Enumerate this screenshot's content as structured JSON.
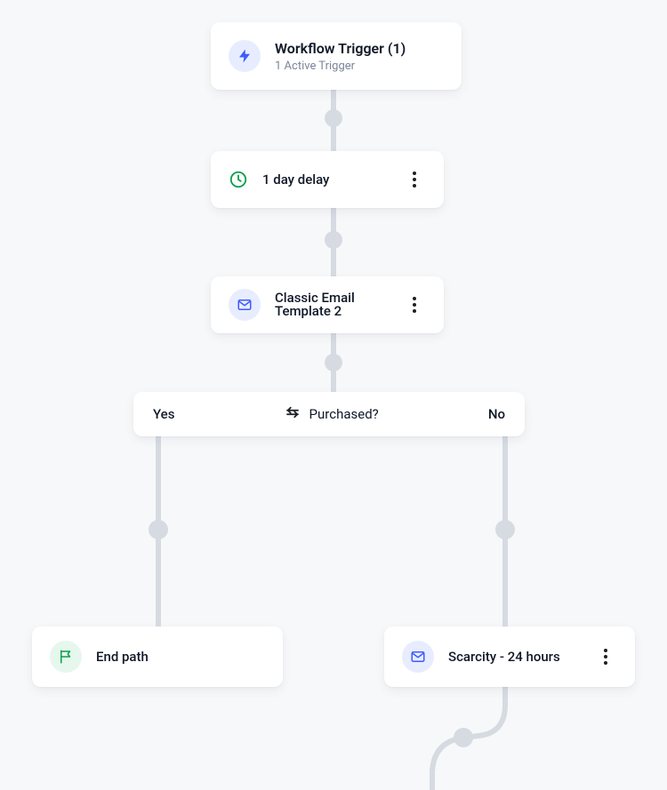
{
  "trigger": {
    "title": "Workflow Trigger (1)",
    "subtitle": "1 Active Trigger"
  },
  "delay": {
    "label": "1 day delay"
  },
  "email1": {
    "label": "Classic Email Template 2"
  },
  "condition": {
    "yes_label": "Yes",
    "no_label": "No",
    "question": "Purchased?"
  },
  "end_path": {
    "label": "End path"
  },
  "email2": {
    "label": "Scarcity - 24 hours"
  },
  "icons": {
    "bolt": "bolt-icon",
    "clock": "clock-icon",
    "mail": "mail-icon",
    "split": "split-icon",
    "flag": "flag-icon",
    "more": "more-icon"
  },
  "colors": {
    "background": "#f7f8fa",
    "card_bg": "#ffffff",
    "text_primary": "#101828",
    "text_secondary": "#7a8699",
    "connector": "#d6dbe2",
    "blue_accent": "#3f5bff",
    "green_accent": "#0aa04a"
  }
}
